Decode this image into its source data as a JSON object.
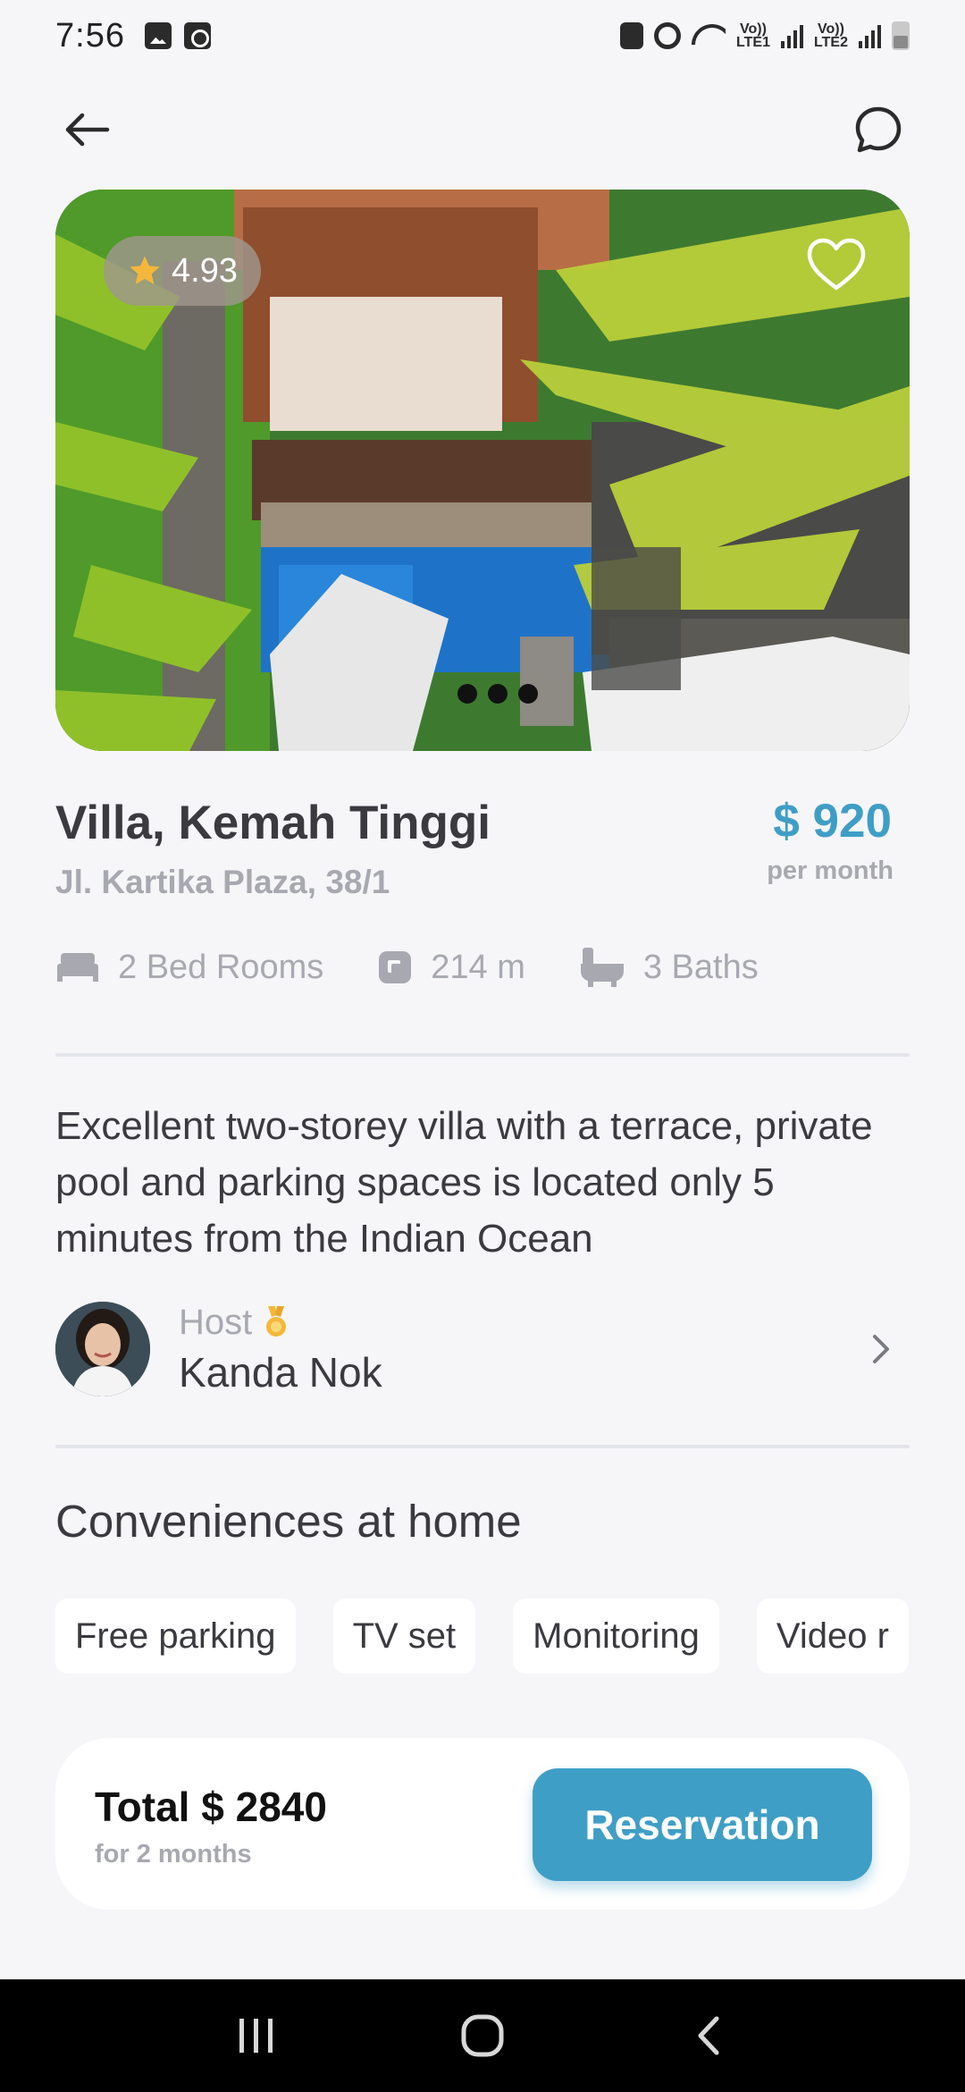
{
  "status_bar": {
    "time": "7:56",
    "lte1": "Vo)) LTE1",
    "lte2": "Vo)) LTE2"
  },
  "listing": {
    "rating": "4.93",
    "title": "Villa, Kemah Tinggi",
    "address": "Jl. Kartika Plaza, 38/1",
    "price": "$ 920",
    "price_unit": "per month",
    "features": [
      {
        "icon": "bed-icon",
        "label": "2 Bed Rooms"
      },
      {
        "icon": "area-icon",
        "label": "214 m"
      },
      {
        "icon": "bathtub-icon",
        "label": "3 Baths"
      }
    ],
    "description": "Excellent two-storey villa with a terrace, private pool and parking spaces is located only 5 minutes from the Indian Ocean",
    "carousel_dots": 3
  },
  "host": {
    "label": "Host",
    "name": "Kanda Nok"
  },
  "conveniences": {
    "title": "Conveniences at home",
    "items": [
      "Free parking",
      "TV set",
      "Monitoring",
      "Video r"
    ]
  },
  "booking": {
    "total": "Total $ 2840",
    "duration": "for 2 months",
    "button_label": "Reservation"
  },
  "colors": {
    "accent": "#3f9ec6",
    "muted": "#a8a9b0",
    "text": "#3a3a3f",
    "background": "#f6f6f9"
  }
}
